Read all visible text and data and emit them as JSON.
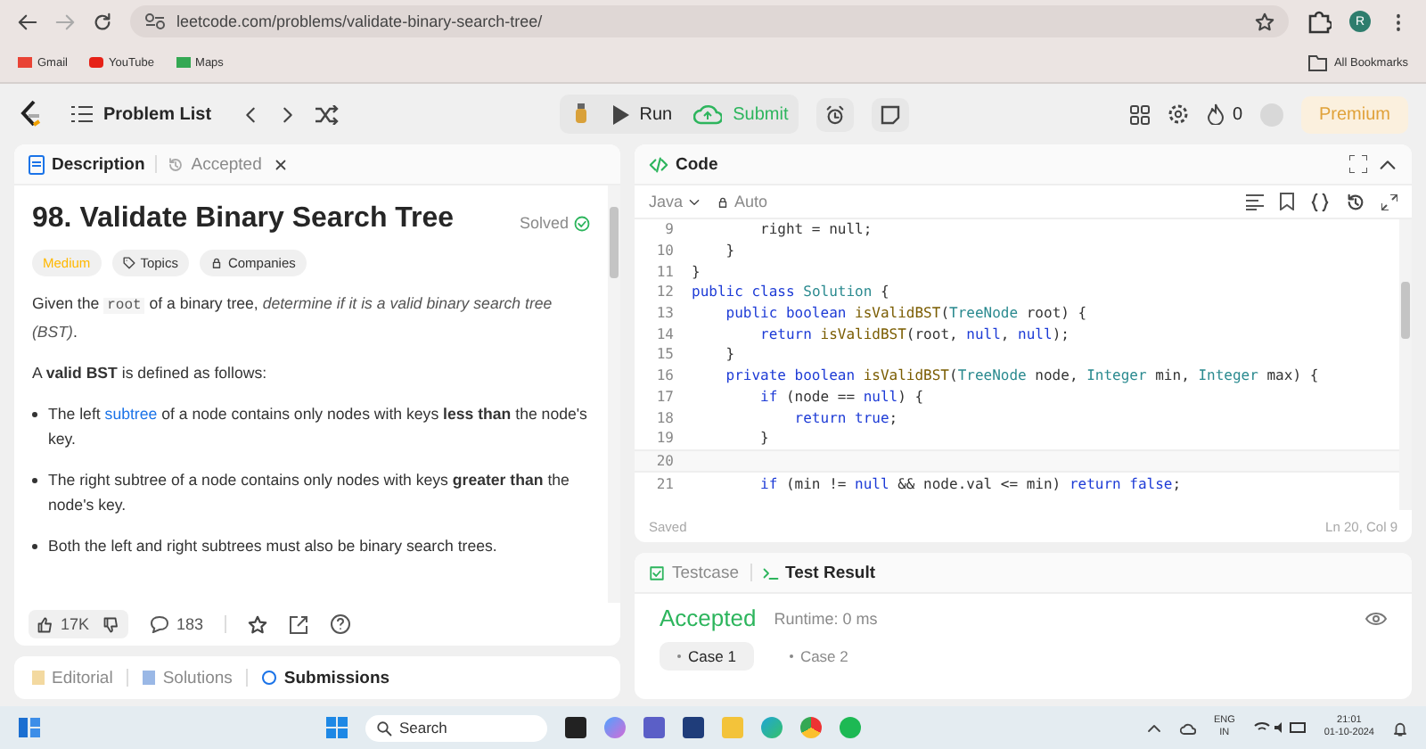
{
  "browser": {
    "url": "leetcode.com/problems/validate-binary-search-tree/",
    "profile_initial": "R",
    "bookmarks": [
      "Gmail",
      "YouTube",
      "Maps"
    ],
    "all_bookmarks": "All Bookmarks"
  },
  "nav": {
    "problem_list": "Problem List",
    "run": "Run",
    "submit": "Submit",
    "streak": "0",
    "premium": "Premium"
  },
  "description_panel": {
    "tabs": [
      {
        "label": "Description",
        "selected": true,
        "closable": false
      },
      {
        "label": "Accepted",
        "selected": false,
        "closable": true
      }
    ],
    "title": "98. Validate Binary Search Tree",
    "status": "Solved",
    "difficulty": "Medium",
    "tags": [
      "Topics",
      "Companies"
    ],
    "paragraphs": [
      {
        "kind": "para",
        "segments": [
          {
            "kind": "text",
            "text": "Given the "
          },
          {
            "kind": "code",
            "text": "root"
          },
          {
            "kind": "text",
            "text": " of a binary tree, "
          },
          {
            "kind": "italic",
            "text": "determine if it is a valid binary search tree (BST)"
          },
          {
            "kind": "text",
            "text": "."
          }
        ]
      },
      {
        "kind": "para",
        "segments": [
          {
            "kind": "text",
            "text": "A "
          },
          {
            "kind": "bold",
            "text": "valid BST"
          },
          {
            "kind": "text",
            "text": " is defined as follows:"
          }
        ]
      },
      {
        "kind": "bullet",
        "segments": [
          {
            "kind": "text",
            "text": "The left "
          },
          {
            "kind": "link",
            "text": "subtree"
          },
          {
            "kind": "text",
            "text": " of a node contains only nodes with keys "
          },
          {
            "kind": "bold",
            "text": "less than"
          },
          {
            "kind": "text",
            "text": " the node's key."
          }
        ]
      },
      {
        "kind": "bullet",
        "segments": [
          {
            "kind": "text",
            "text": "The right subtree of a node contains only nodes with keys "
          },
          {
            "kind": "bold",
            "text": "greater than"
          },
          {
            "kind": "text",
            "text": " the node's key."
          }
        ]
      },
      {
        "kind": "bullet",
        "segments": [
          {
            "kind": "text",
            "text": "Both the left and right subtrees must also be binary search trees."
          }
        ]
      }
    ],
    "likes": "17K",
    "comments": "183",
    "bottom_tabs": [
      {
        "label": "Editorial",
        "selected": false
      },
      {
        "label": "Solutions",
        "selected": false
      },
      {
        "label": "Submissions",
        "selected": true
      }
    ]
  },
  "code_panel": {
    "title": "Code",
    "language": "Java",
    "mode": "Auto",
    "lines": [
      {
        "number": "9",
        "current": false,
        "segments": [
          {
            "kind": "plain",
            "text": "        right = null;"
          }
        ]
      },
      {
        "number": "10",
        "current": false,
        "segments": [
          {
            "kind": "plain",
            "text": "    }"
          }
        ]
      },
      {
        "number": "11",
        "current": false,
        "segments": [
          {
            "kind": "plain",
            "text": "}"
          }
        ]
      },
      {
        "number": "12",
        "current": false,
        "segments": [
          {
            "kind": "kw",
            "text": "public class "
          },
          {
            "kind": "type",
            "text": "Solution"
          },
          {
            "kind": "plain",
            "text": " {"
          }
        ]
      },
      {
        "number": "13",
        "current": false,
        "segments": [
          {
            "kind": "kw",
            "text": "    public boolean "
          },
          {
            "kind": "fn",
            "text": "isValidBST"
          },
          {
            "kind": "plain",
            "text": "("
          },
          {
            "kind": "type",
            "text": "TreeNode"
          },
          {
            "kind": "plain",
            "text": " root) {"
          }
        ]
      },
      {
        "number": "14",
        "current": false,
        "segments": [
          {
            "kind": "kw",
            "text": "        return "
          },
          {
            "kind": "fn",
            "text": "isValidBST"
          },
          {
            "kind": "plain",
            "text": "(root, "
          },
          {
            "kind": "kw",
            "text": "null"
          },
          {
            "kind": "plain",
            "text": ", "
          },
          {
            "kind": "kw",
            "text": "null"
          },
          {
            "kind": "plain",
            "text": ");"
          }
        ]
      },
      {
        "number": "15",
        "current": false,
        "segments": [
          {
            "kind": "plain",
            "text": "    }"
          }
        ]
      },
      {
        "number": "16",
        "current": false,
        "segments": [
          {
            "kind": "kw",
            "text": "    private boolean "
          },
          {
            "kind": "fn",
            "text": "isValidBST"
          },
          {
            "kind": "plain",
            "text": "("
          },
          {
            "kind": "type",
            "text": "TreeNode"
          },
          {
            "kind": "plain",
            "text": " node, "
          },
          {
            "kind": "type",
            "text": "Integer"
          },
          {
            "kind": "plain",
            "text": " min, "
          },
          {
            "kind": "type",
            "text": "Integer"
          },
          {
            "kind": "plain",
            "text": " max) {"
          }
        ]
      },
      {
        "number": "17",
        "current": false,
        "segments": [
          {
            "kind": "kw",
            "text": "        if "
          },
          {
            "kind": "plain",
            "text": "(node == "
          },
          {
            "kind": "kw",
            "text": "null"
          },
          {
            "kind": "plain",
            "text": ") {"
          }
        ]
      },
      {
        "number": "18",
        "current": false,
        "segments": [
          {
            "kind": "kw",
            "text": "            return true"
          },
          {
            "kind": "plain",
            "text": ";"
          }
        ]
      },
      {
        "number": "19",
        "current": false,
        "segments": [
          {
            "kind": "plain",
            "text": "        }"
          }
        ]
      },
      {
        "number": "20",
        "current": true
      },
      {
        "number": "21",
        "current": false,
        "segments": [
          {
            "kind": "kw",
            "text": "        if "
          },
          {
            "kind": "plain",
            "text": "(min != "
          },
          {
            "kind": "kw",
            "text": "null"
          },
          {
            "kind": "plain",
            "text": " && node.val <= min) "
          },
          {
            "kind": "kw",
            "text": "return false"
          },
          {
            "kind": "plain",
            "text": ";"
          }
        ]
      }
    ],
    "saved": "Saved",
    "cursor": "Ln 20, Col 9"
  },
  "test_panel": {
    "tabs": [
      {
        "label": "Testcase",
        "selected": false
      },
      {
        "label": "Test Result",
        "selected": true
      }
    ],
    "result": "Accepted",
    "runtime": "Runtime: 0 ms",
    "cases": [
      {
        "label": "Case 1",
        "selected": true
      },
      {
        "label": "Case 2",
        "selected": false
      }
    ]
  },
  "taskbar": {
    "search": "Search",
    "lang_top": "ENG",
    "lang_bottom": "IN",
    "time": "21:01",
    "date": "01-10-2024"
  }
}
